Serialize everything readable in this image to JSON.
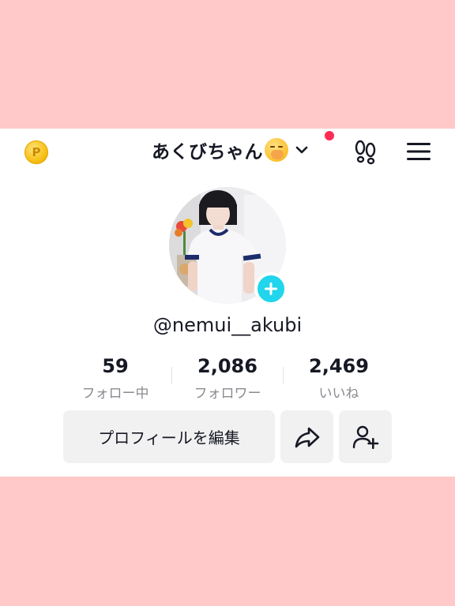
{
  "header": {
    "coin_icon": "points-coin-icon",
    "display_name": "あくびちゃん",
    "name_emoji": "yawning-face-emoji",
    "dropdown_icon": "chevron-down-icon",
    "notification_dot_color": "#fe2c55",
    "footprint_icon": "footprints-icon",
    "menu_icon": "hamburger-menu-icon"
  },
  "profile": {
    "avatar": "profile-photo",
    "add_badge_icon": "plus-icon",
    "badge_color": "#20d5ec",
    "username": "@nemui__akubi"
  },
  "stats": [
    {
      "value": "59",
      "label": "フォロー中"
    },
    {
      "value": "2,086",
      "label": "フォロワー"
    },
    {
      "value": "2,469",
      "label": "いいね"
    }
  ],
  "actions": {
    "edit_profile_label": "プロフィールを編集",
    "share_icon": "share-arrow-icon",
    "add_friend_icon": "add-user-icon"
  }
}
